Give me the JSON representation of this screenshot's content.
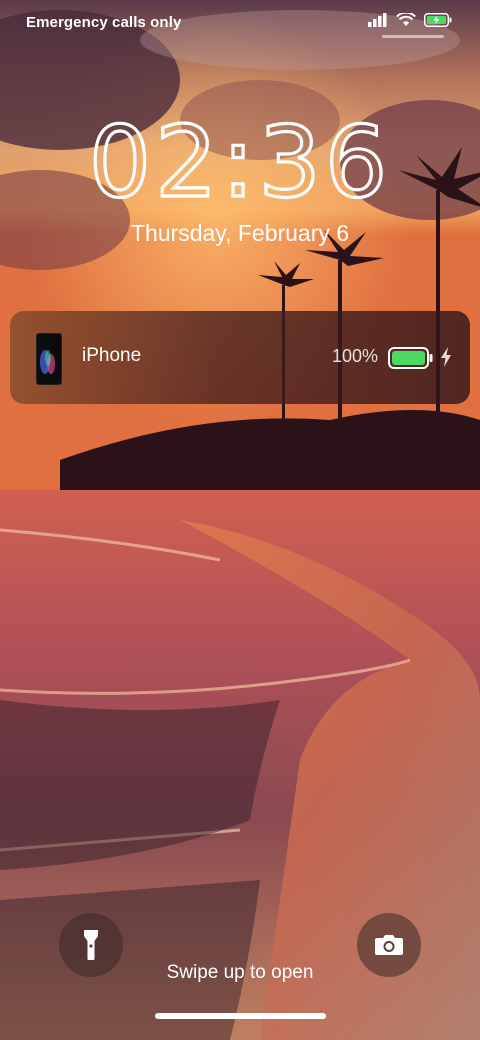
{
  "status_bar": {
    "carrier_text": "Emergency calls only",
    "icons": [
      "signal-icon",
      "wifi-icon",
      "battery-charging-icon"
    ]
  },
  "lock": {
    "time": "02:36",
    "date": "Thursday, February 6"
  },
  "battery_widget": {
    "device_name": "iPhone",
    "percent_text": "100%",
    "level": 1.0,
    "charging": true,
    "battery_color": "#4cd964"
  },
  "bottom": {
    "left_button": "flashlight-icon",
    "right_button": "camera-icon",
    "swipe_text": "Swipe up to open"
  }
}
